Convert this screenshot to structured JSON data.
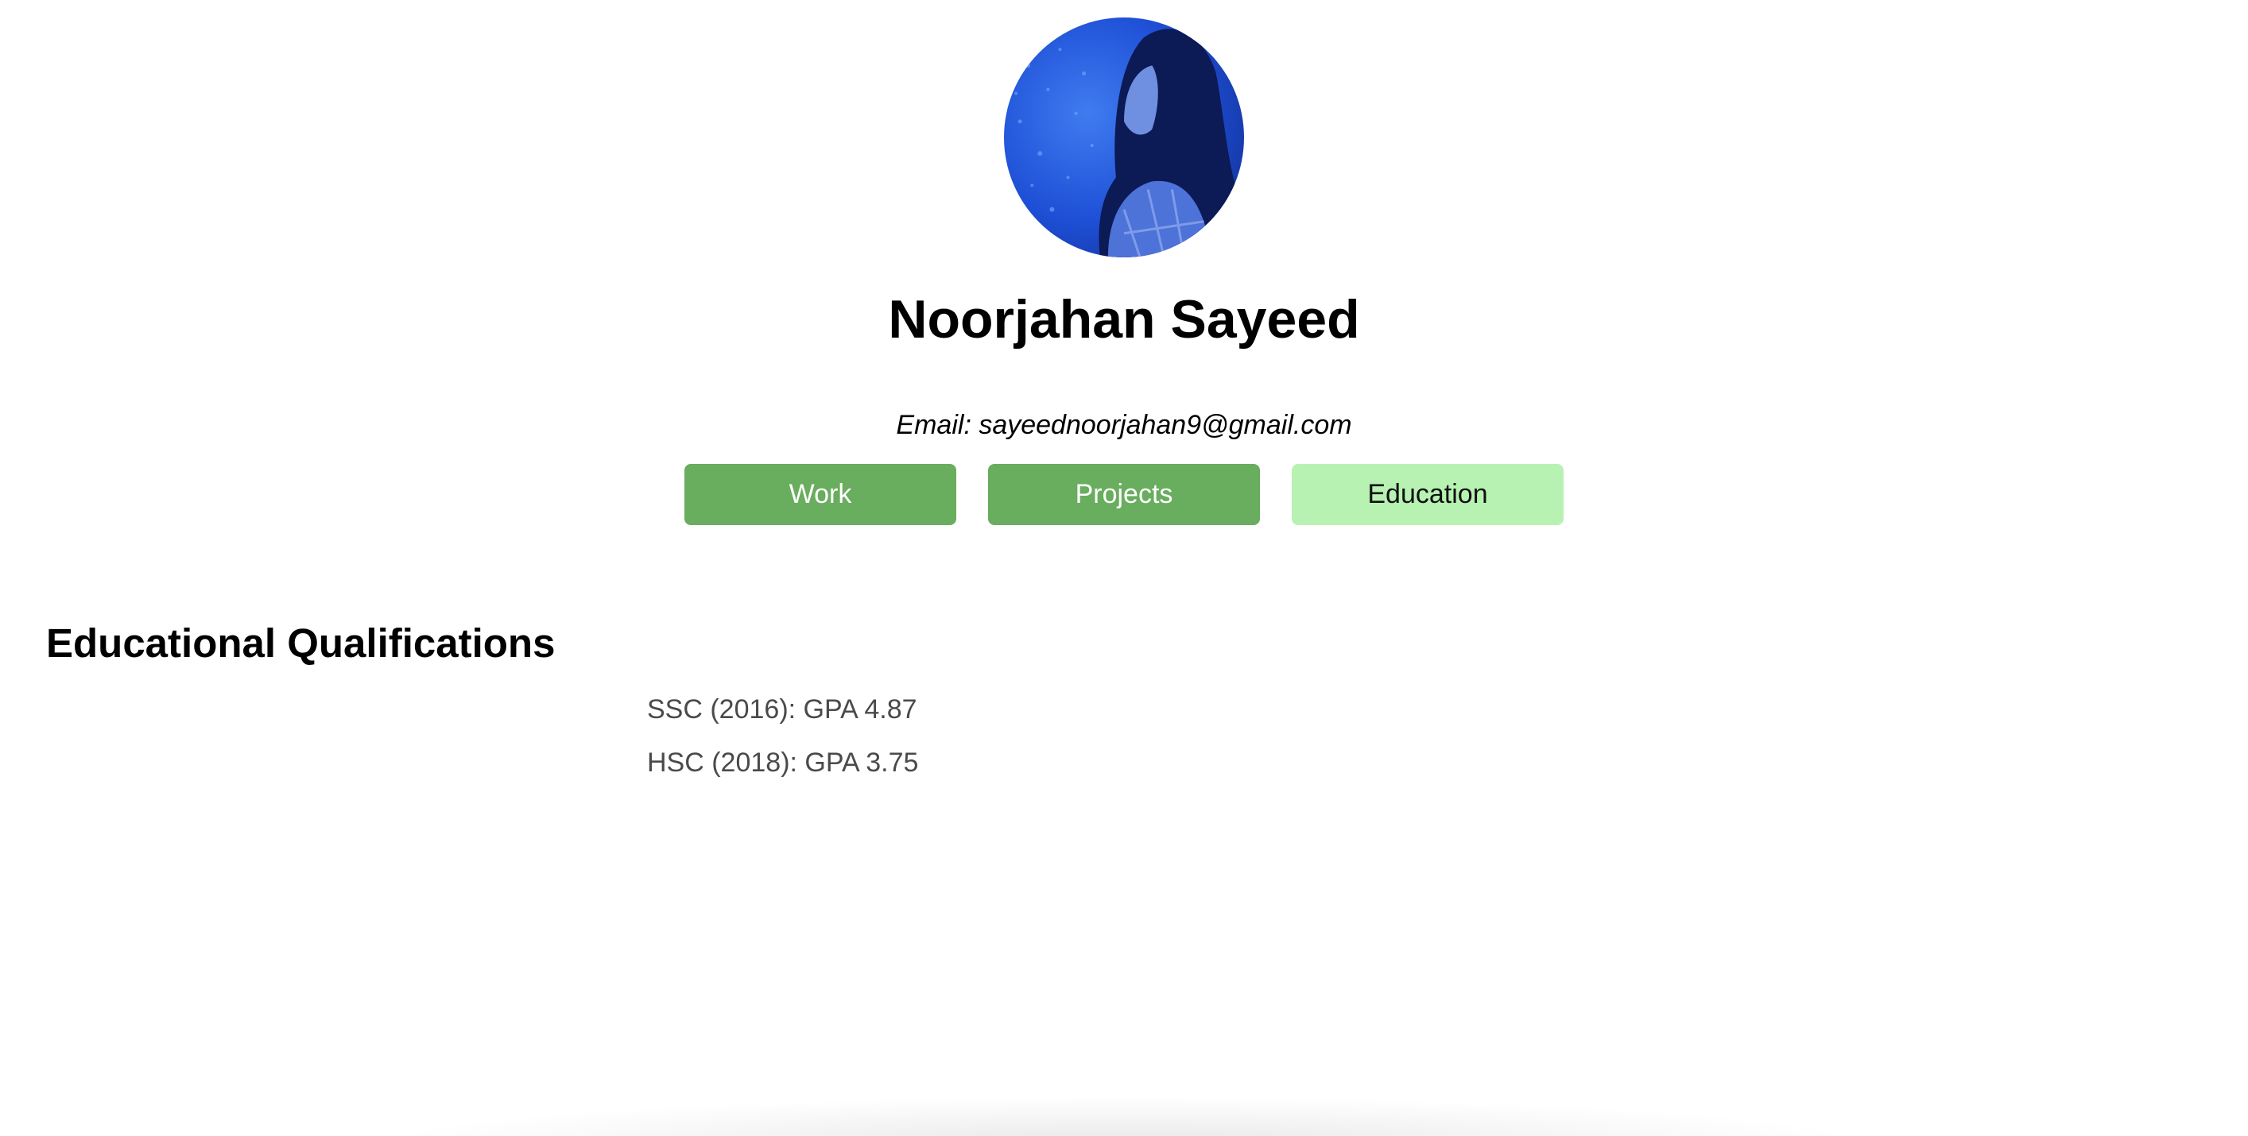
{
  "profile": {
    "name": "Noorjahan Sayeed",
    "email_line": "Email: sayeednoorjahan9@gmail.com"
  },
  "tabs": [
    {
      "label": "Work",
      "state": "inactive"
    },
    {
      "label": "Projects",
      "state": "inactive"
    },
    {
      "label": "Education",
      "state": "active"
    }
  ],
  "education": {
    "title": "Educational Qualifications",
    "items": [
      "SSC (2016): GPA 4.87",
      "HSC (2018): GPA 3.75"
    ]
  },
  "colors": {
    "tab_inactive": "#69ad5e",
    "tab_active": "#b7f2b3",
    "avatar_tint": "#1f4fd0"
  }
}
